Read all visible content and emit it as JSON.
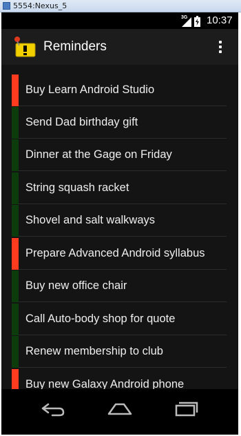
{
  "window": {
    "title": "5554:Nexus_5"
  },
  "status_bar": {
    "network": "3G",
    "time": "10:37"
  },
  "action_bar": {
    "title": "Reminders"
  },
  "colors": {
    "important": "#ff3b1f",
    "normal": "#0c3b0c"
  },
  "reminders": [
    {
      "text": "Buy Learn Android Studio",
      "important": true
    },
    {
      "text": "Send Dad birthday gift",
      "important": false
    },
    {
      "text": "Dinner at the Gage on Friday",
      "important": false
    },
    {
      "text": "String squash racket",
      "important": false
    },
    {
      "text": "Shovel and salt walkways",
      "important": false
    },
    {
      "text": "Prepare Advanced Android syllabus",
      "important": true
    },
    {
      "text": "Buy new office chair",
      "important": false
    },
    {
      "text": "Call Auto-body shop for quote",
      "important": false
    },
    {
      "text": "Renew membership to club",
      "important": false
    },
    {
      "text": "Buy new Galaxy Android phone",
      "important": true
    }
  ],
  "nav_icons": [
    "back-icon",
    "home-icon",
    "recents-icon"
  ]
}
